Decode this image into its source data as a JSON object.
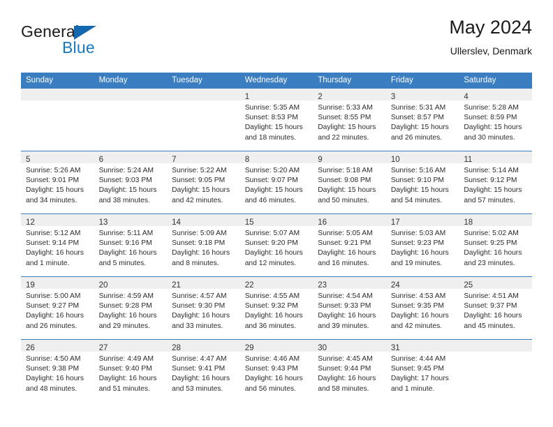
{
  "brand": {
    "name_top": "General",
    "name_bottom": "Blue",
    "triangle_color": "#1468b0",
    "blue_color": "#1779c4"
  },
  "header": {
    "title": "May 2024",
    "subtitle": "Ullerslev, Denmark"
  },
  "colors": {
    "header_bar": "#3a7dc0",
    "daynum_bar": "#efefef",
    "text": "#2b2b2b"
  },
  "weekdays": [
    "Sunday",
    "Monday",
    "Tuesday",
    "Wednesday",
    "Thursday",
    "Friday",
    "Saturday"
  ],
  "weeks": [
    [
      {
        "day": "",
        "lines": []
      },
      {
        "day": "",
        "lines": []
      },
      {
        "day": "",
        "lines": []
      },
      {
        "day": "1",
        "lines": [
          "Sunrise: 5:35 AM",
          "Sunset: 8:53 PM",
          "Daylight: 15 hours",
          "and 18 minutes."
        ]
      },
      {
        "day": "2",
        "lines": [
          "Sunrise: 5:33 AM",
          "Sunset: 8:55 PM",
          "Daylight: 15 hours",
          "and 22 minutes."
        ]
      },
      {
        "day": "3",
        "lines": [
          "Sunrise: 5:31 AM",
          "Sunset: 8:57 PM",
          "Daylight: 15 hours",
          "and 26 minutes."
        ]
      },
      {
        "day": "4",
        "lines": [
          "Sunrise: 5:28 AM",
          "Sunset: 8:59 PM",
          "Daylight: 15 hours",
          "and 30 minutes."
        ]
      }
    ],
    [
      {
        "day": "5",
        "lines": [
          "Sunrise: 5:26 AM",
          "Sunset: 9:01 PM",
          "Daylight: 15 hours",
          "and 34 minutes."
        ]
      },
      {
        "day": "6",
        "lines": [
          "Sunrise: 5:24 AM",
          "Sunset: 9:03 PM",
          "Daylight: 15 hours",
          "and 38 minutes."
        ]
      },
      {
        "day": "7",
        "lines": [
          "Sunrise: 5:22 AM",
          "Sunset: 9:05 PM",
          "Daylight: 15 hours",
          "and 42 minutes."
        ]
      },
      {
        "day": "8",
        "lines": [
          "Sunrise: 5:20 AM",
          "Sunset: 9:07 PM",
          "Daylight: 15 hours",
          "and 46 minutes."
        ]
      },
      {
        "day": "9",
        "lines": [
          "Sunrise: 5:18 AM",
          "Sunset: 9:08 PM",
          "Daylight: 15 hours",
          "and 50 minutes."
        ]
      },
      {
        "day": "10",
        "lines": [
          "Sunrise: 5:16 AM",
          "Sunset: 9:10 PM",
          "Daylight: 15 hours",
          "and 54 minutes."
        ]
      },
      {
        "day": "11",
        "lines": [
          "Sunrise: 5:14 AM",
          "Sunset: 9:12 PM",
          "Daylight: 15 hours",
          "and 57 minutes."
        ]
      }
    ],
    [
      {
        "day": "12",
        "lines": [
          "Sunrise: 5:12 AM",
          "Sunset: 9:14 PM",
          "Daylight: 16 hours",
          "and 1 minute."
        ]
      },
      {
        "day": "13",
        "lines": [
          "Sunrise: 5:11 AM",
          "Sunset: 9:16 PM",
          "Daylight: 16 hours",
          "and 5 minutes."
        ]
      },
      {
        "day": "14",
        "lines": [
          "Sunrise: 5:09 AM",
          "Sunset: 9:18 PM",
          "Daylight: 16 hours",
          "and 8 minutes."
        ]
      },
      {
        "day": "15",
        "lines": [
          "Sunrise: 5:07 AM",
          "Sunset: 9:20 PM",
          "Daylight: 16 hours",
          "and 12 minutes."
        ]
      },
      {
        "day": "16",
        "lines": [
          "Sunrise: 5:05 AM",
          "Sunset: 9:21 PM",
          "Daylight: 16 hours",
          "and 16 minutes."
        ]
      },
      {
        "day": "17",
        "lines": [
          "Sunrise: 5:03 AM",
          "Sunset: 9:23 PM",
          "Daylight: 16 hours",
          "and 19 minutes."
        ]
      },
      {
        "day": "18",
        "lines": [
          "Sunrise: 5:02 AM",
          "Sunset: 9:25 PM",
          "Daylight: 16 hours",
          "and 23 minutes."
        ]
      }
    ],
    [
      {
        "day": "19",
        "lines": [
          "Sunrise: 5:00 AM",
          "Sunset: 9:27 PM",
          "Daylight: 16 hours",
          "and 26 minutes."
        ]
      },
      {
        "day": "20",
        "lines": [
          "Sunrise: 4:59 AM",
          "Sunset: 9:28 PM",
          "Daylight: 16 hours",
          "and 29 minutes."
        ]
      },
      {
        "day": "21",
        "lines": [
          "Sunrise: 4:57 AM",
          "Sunset: 9:30 PM",
          "Daylight: 16 hours",
          "and 33 minutes."
        ]
      },
      {
        "day": "22",
        "lines": [
          "Sunrise: 4:55 AM",
          "Sunset: 9:32 PM",
          "Daylight: 16 hours",
          "and 36 minutes."
        ]
      },
      {
        "day": "23",
        "lines": [
          "Sunrise: 4:54 AM",
          "Sunset: 9:33 PM",
          "Daylight: 16 hours",
          "and 39 minutes."
        ]
      },
      {
        "day": "24",
        "lines": [
          "Sunrise: 4:53 AM",
          "Sunset: 9:35 PM",
          "Daylight: 16 hours",
          "and 42 minutes."
        ]
      },
      {
        "day": "25",
        "lines": [
          "Sunrise: 4:51 AM",
          "Sunset: 9:37 PM",
          "Daylight: 16 hours",
          "and 45 minutes."
        ]
      }
    ],
    [
      {
        "day": "26",
        "lines": [
          "Sunrise: 4:50 AM",
          "Sunset: 9:38 PM",
          "Daylight: 16 hours",
          "and 48 minutes."
        ]
      },
      {
        "day": "27",
        "lines": [
          "Sunrise: 4:49 AM",
          "Sunset: 9:40 PM",
          "Daylight: 16 hours",
          "and 51 minutes."
        ]
      },
      {
        "day": "28",
        "lines": [
          "Sunrise: 4:47 AM",
          "Sunset: 9:41 PM",
          "Daylight: 16 hours",
          "and 53 minutes."
        ]
      },
      {
        "day": "29",
        "lines": [
          "Sunrise: 4:46 AM",
          "Sunset: 9:43 PM",
          "Daylight: 16 hours",
          "and 56 minutes."
        ]
      },
      {
        "day": "30",
        "lines": [
          "Sunrise: 4:45 AM",
          "Sunset: 9:44 PM",
          "Daylight: 16 hours",
          "and 58 minutes."
        ]
      },
      {
        "day": "31",
        "lines": [
          "Sunrise: 4:44 AM",
          "Sunset: 9:45 PM",
          "Daylight: 17 hours",
          "and 1 minute."
        ]
      },
      {
        "day": "",
        "lines": []
      }
    ]
  ]
}
